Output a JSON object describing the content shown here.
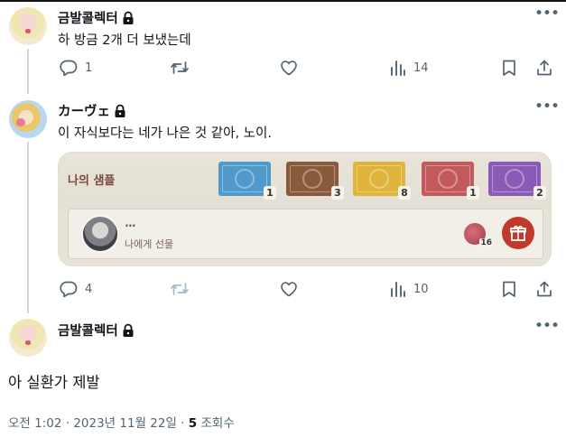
{
  "tweets": [
    {
      "author": "금발콜렉터",
      "text": "하 방금 2개 더 보냈는데",
      "replies": "1",
      "retweets": "",
      "views": "14"
    },
    {
      "author": "カーヴェ",
      "text": "이 자식보다는 네가 나은 것 같아, 노이.",
      "replies": "4",
      "retweets": "",
      "views": "10",
      "media": {
        "title": "나의 샘플",
        "samples": [
          {
            "color": "#4f9acb",
            "count": "1"
          },
          {
            "color": "#8a5a3c",
            "count": "3"
          },
          {
            "color": "#e0b43a",
            "count": "8"
          },
          {
            "color": "#c25a5c",
            "count": "1"
          },
          {
            "color": "#8a5ab6",
            "count": "2"
          }
        ],
        "gift_dots": "...",
        "gift_label": "나에게 선물",
        "token_count": "16"
      }
    }
  ],
  "main_tweet": {
    "author": "금발콜렉터",
    "text": "아 실환가 제발",
    "time": "오전 1:02 · 2023년 11월 22일 · ",
    "views_count": "5",
    "views_label": " 조회수"
  },
  "colors": {
    "text_primary": "#0f1419",
    "text_secondary": "#536471",
    "thread_line": "#cfd9de"
  },
  "icons": [
    "lock-icon",
    "more-icon",
    "reply-icon",
    "retweet-icon",
    "like-icon",
    "views-icon",
    "bookmark-icon",
    "share-icon",
    "gift-icon"
  ]
}
